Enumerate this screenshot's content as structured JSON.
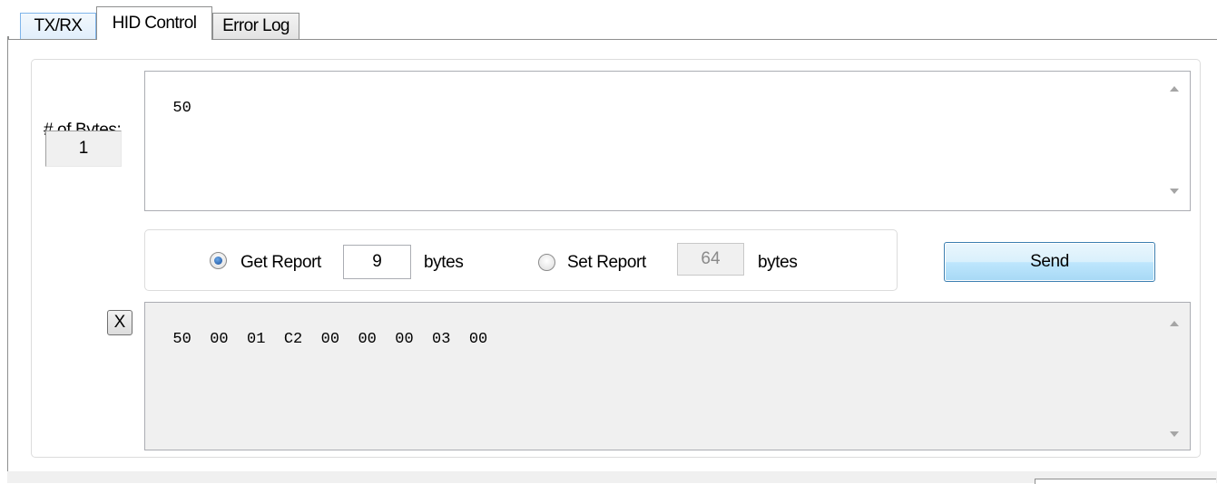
{
  "tabs": [
    {
      "label": "TX/RX"
    },
    {
      "label": "HID Control"
    },
    {
      "label": "Error Log"
    }
  ],
  "bytes_panel": {
    "label": "# of Bytes:",
    "count": "1"
  },
  "input_area": {
    "value": "50"
  },
  "report": {
    "get_label": "Get Report",
    "get_value": "9",
    "get_unit": "bytes",
    "get_selected": true,
    "set_label": "Set Report",
    "set_value": "64",
    "set_unit": "bytes",
    "set_selected": false
  },
  "send_button": {
    "label": "Send"
  },
  "clear_button": {
    "label": "X"
  },
  "output_area": {
    "value": "50  00  01  C2  00  00  00  03  00"
  }
}
